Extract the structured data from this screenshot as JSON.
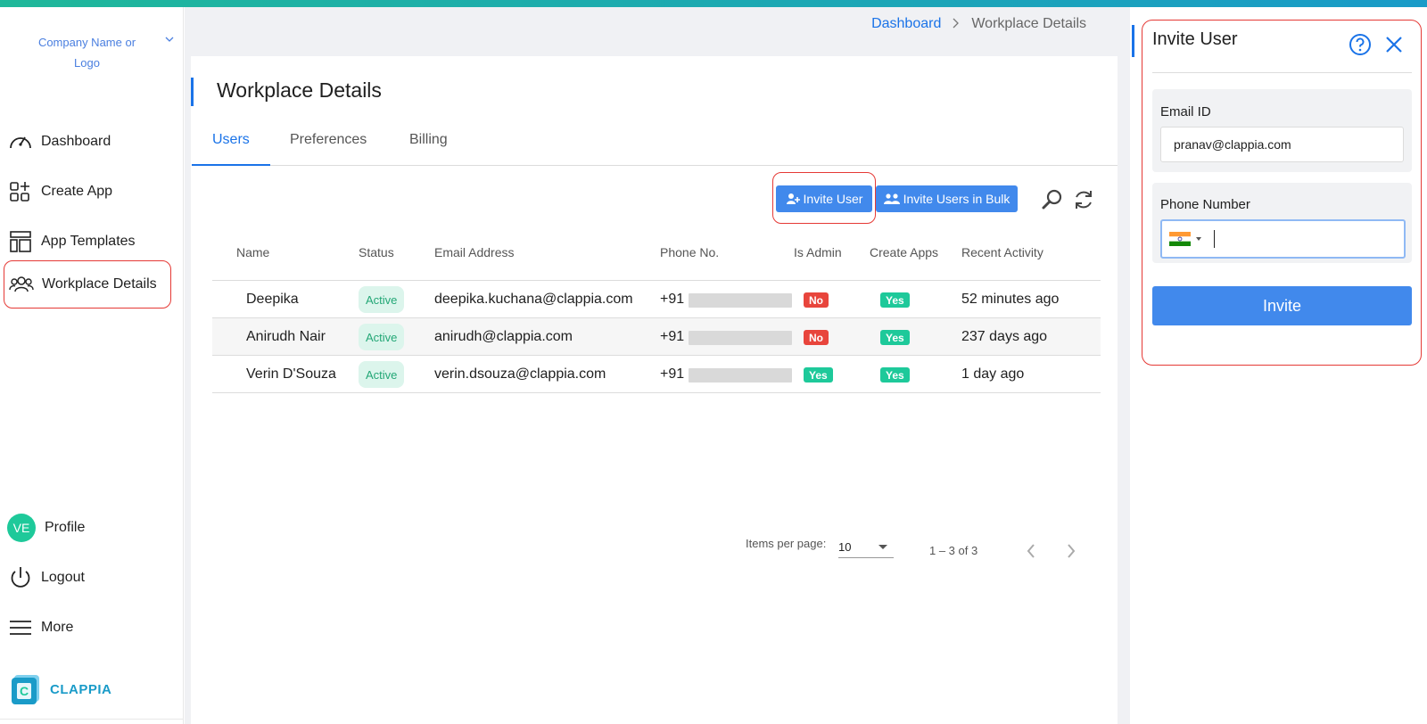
{
  "company": {
    "label": "Company Name or Logo"
  },
  "sidebar": {
    "items": [
      {
        "label": "Dashboard",
        "icon": "speedometer-icon"
      },
      {
        "label": "Create App",
        "icon": "create-app-icon"
      },
      {
        "label": "App Templates",
        "icon": "templates-icon"
      },
      {
        "label": "Workplace Details",
        "icon": "users-icon"
      }
    ],
    "profile": {
      "initials": "VE",
      "label": "Profile"
    },
    "logout": "Logout",
    "more": "More",
    "brand": "CLAPPIA"
  },
  "breadcrumb": {
    "link": "Dashboard",
    "current": "Workplace Details"
  },
  "page": {
    "title": "Workplace Details"
  },
  "tabs": [
    "Users",
    "Preferences",
    "Billing"
  ],
  "toolbar": {
    "invite_user": "Invite User",
    "invite_bulk": "Invite Users in Bulk"
  },
  "table": {
    "headers": [
      "Name",
      "Status",
      "Email Address",
      "Phone No.",
      "Is Admin",
      "Create Apps",
      "Recent Activity"
    ],
    "rows": [
      {
        "name": "Deepika",
        "status": "Active",
        "email": "deepika.kuchana@clappia.com",
        "phone_prefix": "+91",
        "is_admin": "No",
        "create_apps": "Yes",
        "activity": "52 minutes ago"
      },
      {
        "name": "Anirudh Nair",
        "status": "Active",
        "email": "anirudh@clappia.com",
        "phone_prefix": "+91",
        "is_admin": "No",
        "create_apps": "Yes",
        "activity": "237 days ago"
      },
      {
        "name": "Verin D'Souza",
        "status": "Active",
        "email": "verin.dsouza@clappia.com",
        "phone_prefix": "+91",
        "is_admin": "Yes",
        "create_apps": "Yes",
        "activity": "1 day ago"
      }
    ]
  },
  "pagination": {
    "items_label": "Items per page:",
    "items_value": "10",
    "range": "1 – 3 of 3"
  },
  "invite_panel": {
    "title": "Invite User",
    "email_label": "Email ID",
    "email_value": "pranav@clappia.com",
    "phone_label": "Phone Number",
    "phone_value": "",
    "country": "india-flag-icon",
    "submit": "Invite"
  },
  "colors": {
    "accent": "#4189ec",
    "link": "#1a73e8",
    "active_green": "#1ec99a",
    "no_red": "#e8453c",
    "highlight": "#e53935"
  }
}
